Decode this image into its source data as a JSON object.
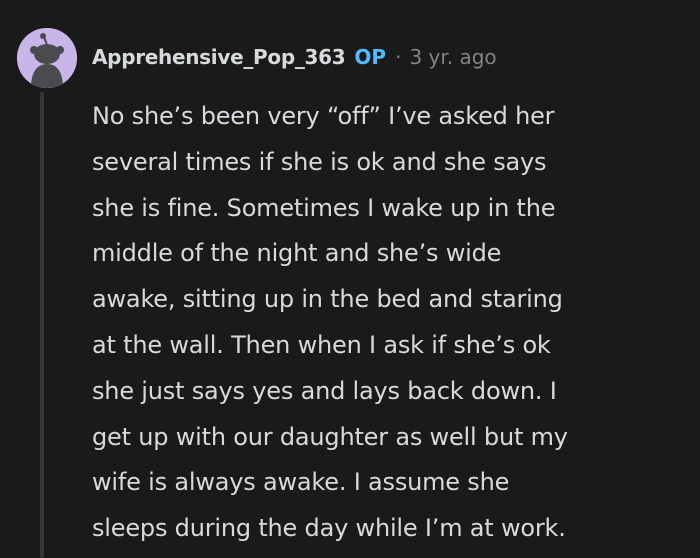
{
  "comment": {
    "author": "Apprehensive_Pop_363",
    "op_badge": "OP",
    "separator": "·",
    "timestamp": "3 yr. ago",
    "avatar_icon": "snoo-avatar-icon",
    "avatar_color": "#c9b6e8",
    "body_lines": [
      "No she’s been very “off” I’ve asked her",
      "several times if she is ok and she says",
      "she is fine. Sometimes I wake up in the",
      "middle of the night and she’s wide",
      "awake, sitting up in the bed and staring",
      "at the wall. Then when I ask if she’s ok",
      "she just says yes and lays back down. I",
      "get up with our daughter as well but my",
      "wife is always awake. I assume she",
      "sleeps during the day while I’m at work."
    ]
  },
  "colors": {
    "background": "#1a1a1b",
    "text": "#d7dadc",
    "muted": "#818384",
    "op_accent": "#4fbcff",
    "thread_line": "#343536"
  }
}
